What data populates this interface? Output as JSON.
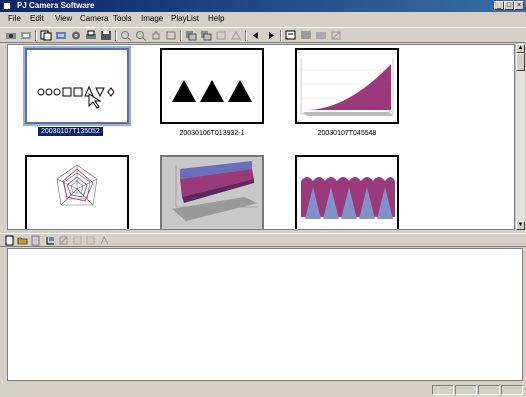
{
  "window": {
    "title": "PJ Camera Software"
  },
  "menu": [
    "File",
    "Edit",
    "View",
    "Camera",
    "Tools",
    "Image",
    "PlayList",
    "Help"
  ],
  "toolbar_icons": [
    "camera-icon",
    "film-icon",
    "copy-icon",
    "capture-icon",
    "settings-icon",
    "print-icon",
    "save-icon",
    "zoom-in-icon",
    "zoom-out-icon",
    "hand-icon",
    "fit-icon",
    "rotate-left-icon",
    "rotate-right-icon",
    "crop-icon",
    "adjust-icon",
    "prev-icon",
    "next-icon",
    "export-icon",
    "slideshow-icon",
    "image-info-icon",
    "settings2-icon"
  ],
  "thumbnails": [
    {
      "caption": "20030107T135052",
      "selected": true
    },
    {
      "caption": "20030106T013932-1"
    },
    {
      "caption": "20030107T045548"
    },
    {
      "caption": ""
    },
    {
      "caption": ""
    },
    {
      "caption": ""
    }
  ],
  "playlist_toolbar_icons": [
    "new-icon",
    "open-icon",
    "save-icon",
    "add-icon",
    "remove-icon",
    "move-up-icon",
    "move-down-icon",
    "properties-icon"
  ],
  "colors": {
    "title_start": "#0a246a",
    "title_end": "#3a6ea5",
    "chrome": "#d4d0c8",
    "selection": "#0a246a",
    "chart_magenta": "#9a3a7a",
    "chart_blue": "#6a70b8"
  }
}
